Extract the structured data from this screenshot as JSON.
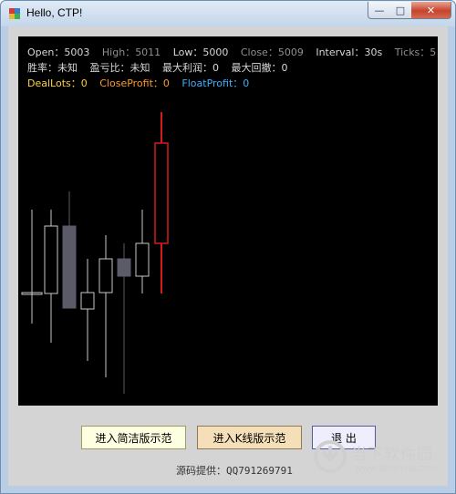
{
  "window": {
    "title": "Hello, CTP!"
  },
  "controls": {
    "minimize": "—",
    "maximize": "□",
    "close": "✕"
  },
  "stats": {
    "open_label": "Open：",
    "open_value": "5003",
    "high_label": "High：",
    "high_value": "5011",
    "low_label": "Low：",
    "low_value": "5000",
    "close_label": "Close：",
    "close_value": "5009",
    "interval_label": "Interval：",
    "interval_value": "30s",
    "ticks_label": "Ticks：",
    "ticks_value": "5",
    "winrate_label": "胜率：",
    "winrate_value": "未知",
    "pl_ratio_label": "盈亏比：",
    "pl_ratio_value": "未知",
    "max_profit_label": "最大利润：",
    "max_profit_value": "0",
    "max_drawdown_label": "最大回撤：",
    "max_drawdown_value": "0",
    "deallots_label": "DealLots：",
    "deallots_value": "0",
    "closeprofit_label": "CloseProfit：",
    "closeprofit_value": "0",
    "floatprofit_label": "FloatProfit：",
    "floatprofit_value": "0"
  },
  "colors": {
    "up_candle": "#d41b1b",
    "down_candle": "#5a5a68",
    "neutral_candle": "#c8c8c8"
  },
  "chart_data": {
    "type": "candlestick",
    "candles": [
      {
        "open": 0,
        "high": 0,
        "low": 0,
        "close": 0,
        "style": "line"
      },
      {
        "open": 0,
        "high": 0,
        "low": 0,
        "close": 0,
        "style": "hollow"
      },
      {
        "open": 0,
        "high": 0,
        "low": 0,
        "close": 0,
        "style": "filled"
      },
      {
        "open": 0,
        "high": 0,
        "low": 0,
        "close": 0,
        "style": "hollow"
      },
      {
        "open": 0,
        "high": 0,
        "low": 0,
        "close": 0,
        "style": "hollow"
      },
      {
        "open": 0,
        "high": 0,
        "low": 0,
        "close": 0,
        "style": "filled"
      },
      {
        "open": 0,
        "high": 0,
        "low": 0,
        "close": 0,
        "style": "hollow"
      },
      {
        "open": 5003,
        "high": 5011,
        "low": 5000,
        "close": 5009,
        "style": "up"
      }
    ]
  },
  "buttons": {
    "simple_demo": "进入简洁版示范",
    "kline_demo": "进入K线版示范",
    "exit": "退 出"
  },
  "footer": {
    "source": "源码提供：QQ791269791"
  },
  "watermark": {
    "brand": "当下软件园",
    "url": "www.downxia.com"
  }
}
